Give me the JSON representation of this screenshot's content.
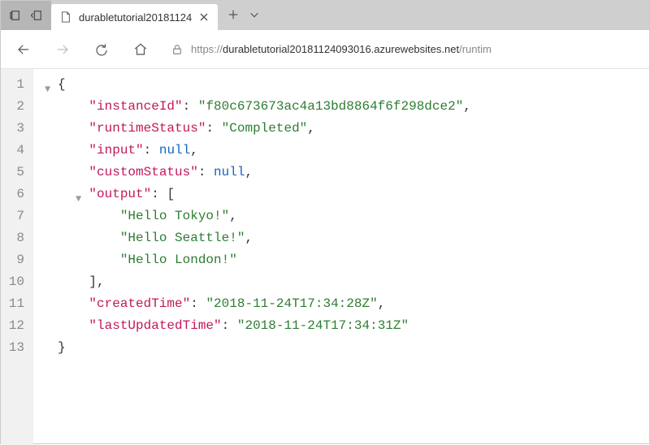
{
  "titlebar": {
    "tab_title": "durabletutorial20181124"
  },
  "navbar": {
    "url_scheme": "https://",
    "url_host": "durabletutorial20181124093016.azurewebsites.net",
    "url_path": "/runtim"
  },
  "json_lines": [
    "{",
    "    \"instanceId\": \"f80c673673ac4a13bd8864f6f298dce2\",",
    "    \"runtimeStatus\": \"Completed\",",
    "    \"input\": null,",
    "    \"customStatus\": null,",
    "    \"output\": [",
    "        \"Hello Tokyo!\",",
    "        \"Hello Seattle!\",",
    "        \"Hello London!\"",
    "    ],",
    "    \"createdTime\": \"2018-11-24T17:34:28Z\",",
    "    \"lastUpdatedTime\": \"2018-11-24T17:34:31Z\"",
    "}"
  ],
  "fold_markers": {
    "0": true,
    "5": true
  },
  "line_numbers": [
    "1",
    "2",
    "3",
    "4",
    "5",
    "6",
    "7",
    "8",
    "9",
    "10",
    "11",
    "12",
    "13"
  ]
}
